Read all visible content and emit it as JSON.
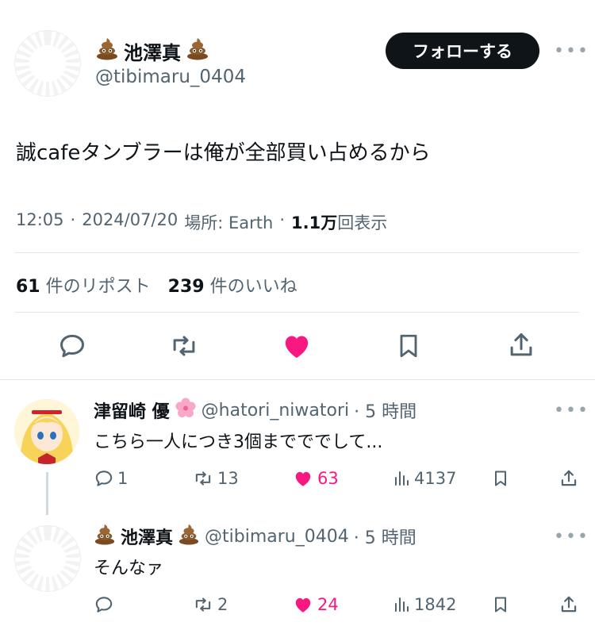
{
  "main_tweet": {
    "display_name": "池澤真",
    "handle": "@tibimaru_0404",
    "follow_label": "フォローする",
    "more_label": "•••",
    "text": "誠cafeタンブラーは俺が全部買い占めるから",
    "meta": {
      "time": "12:05",
      "sep": "·",
      "date": "2024/07/20",
      "location": "場所: Earth",
      "views_value": "1.1万",
      "views_label": "回表示"
    },
    "reposts_count": "61",
    "reposts_label": "件のリポスト",
    "likes_count": "239",
    "likes_label": "件のいいね",
    "actions": [
      "reply-icon",
      "retweet-icon",
      "heart-icon",
      "bookmark-icon",
      "share-icon"
    ],
    "liked": true
  },
  "replies": [
    {
      "display_name": "津留崎 優",
      "handle": "@hatori_niwatori",
      "time": "· 5 時間",
      "text": "こちら一人につき3個までででして...",
      "replies": "1",
      "retweets": "13",
      "likes": "63",
      "views": "4137"
    },
    {
      "display_name": "池澤真",
      "handle": "@tibimaru_0404",
      "time": "· 5 時間",
      "text": "そんなァ",
      "replies": "",
      "retweets": "2",
      "likes": "24",
      "views": "1842"
    }
  ],
  "colors": {
    "like": "#f91880",
    "text": "#0f1419",
    "muted": "#536471",
    "divider": "#e4e8ea"
  }
}
